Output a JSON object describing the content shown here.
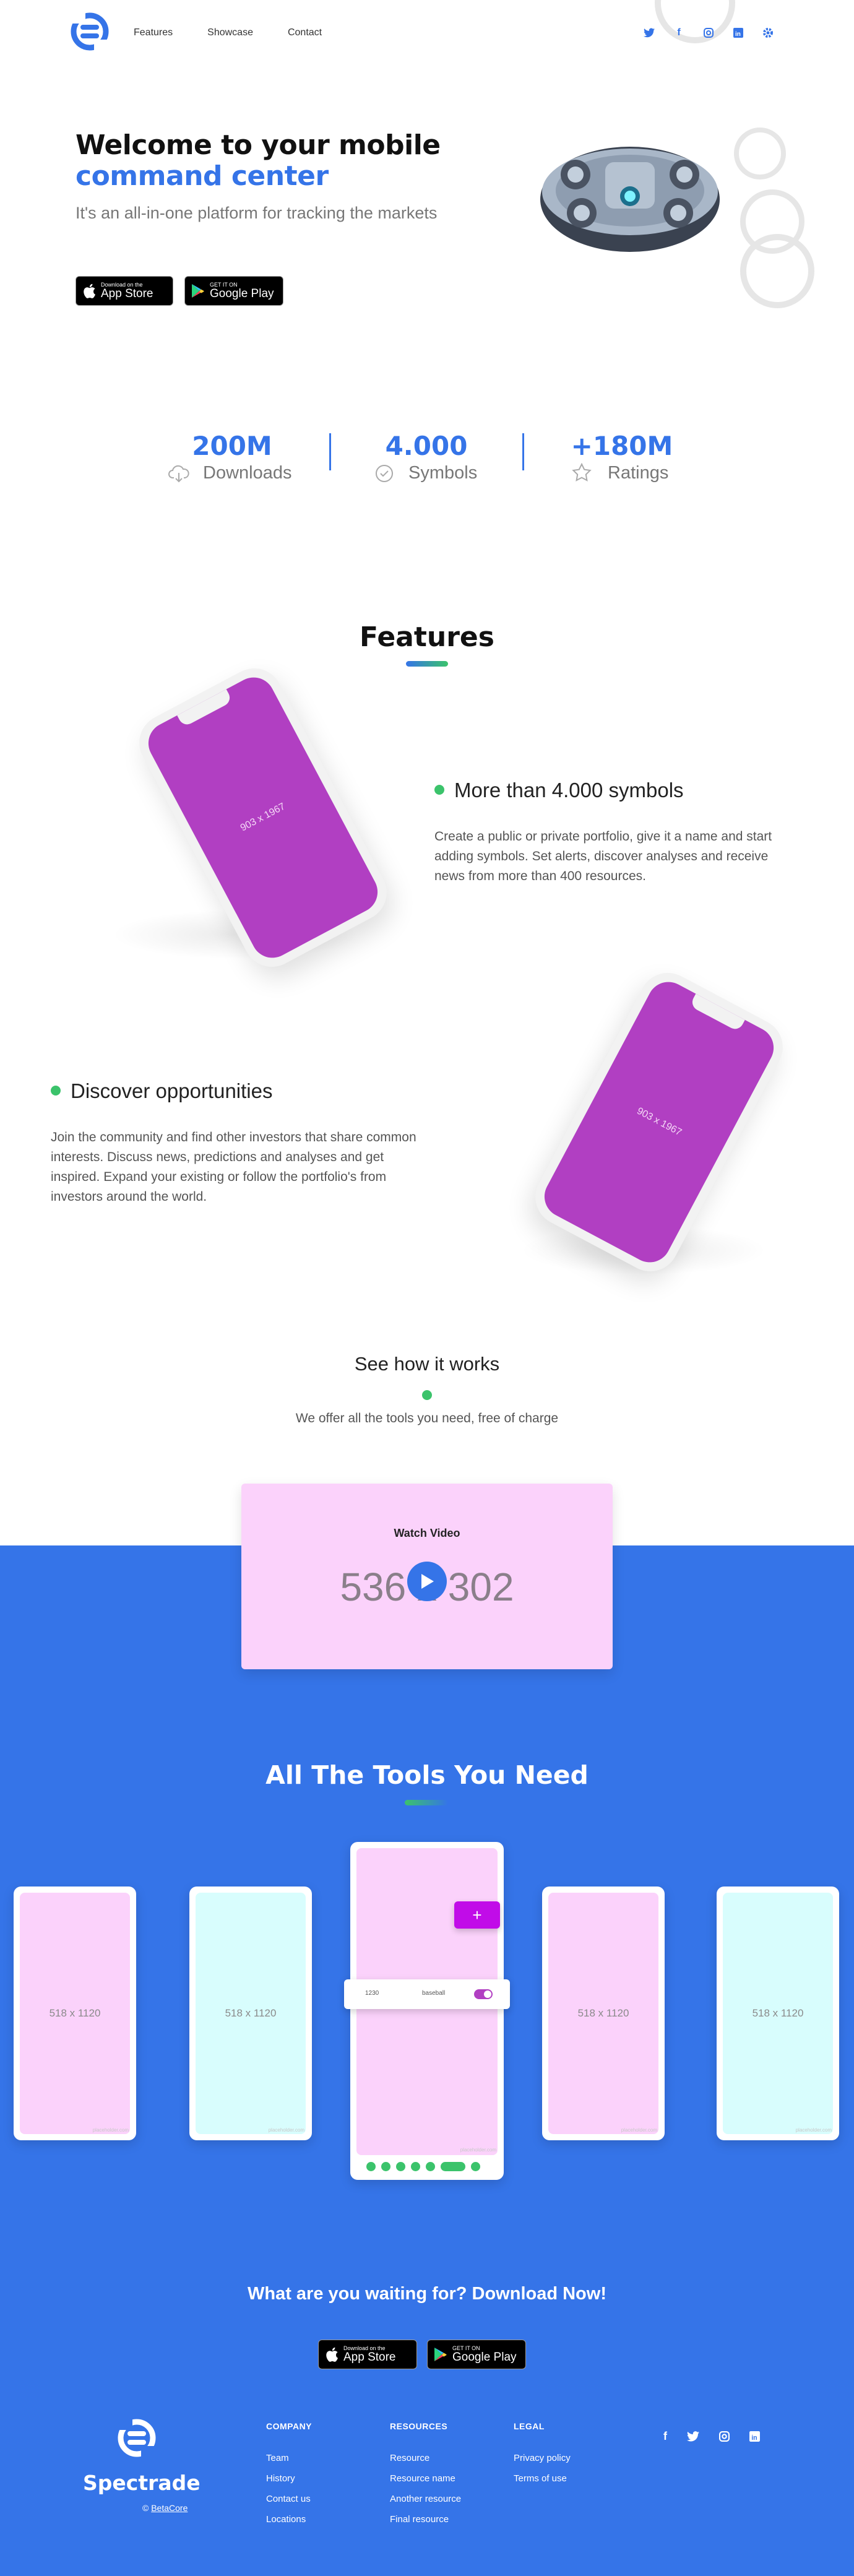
{
  "header": {
    "nav": [
      "Features",
      "Showcase",
      "Contact"
    ],
    "social_icons": [
      "twitter-icon",
      "facebook-icon",
      "instagram-icon",
      "linkedin-icon",
      "settings-icon"
    ]
  },
  "hero": {
    "title_line1": "Welcome to your mobile",
    "title_line2": "command center",
    "subtitle": "It's an all-in-one platform for tracking the markets",
    "app_store": {
      "small": "Download on the",
      "large": "App Store"
    },
    "google_play": {
      "small": "GET IT ON",
      "large": "Google Play"
    }
  },
  "stats": [
    {
      "value": "200M",
      "label": "Downloads",
      "icon": "cloud-download-icon"
    },
    {
      "value": "4.000",
      "label": "Symbols",
      "icon": "check-circle-icon"
    },
    {
      "value": "+180M",
      "label": "Ratings",
      "icon": "star-icon"
    }
  ],
  "features": {
    "title": "Features",
    "items": [
      {
        "heading": "More than 4.000 symbols",
        "text": "Create a public or private portfolio, give it a name and start adding symbols. Set alerts, discover analyses and receive news from more than 400 resources.",
        "placeholder": "903 x 1967"
      },
      {
        "heading": "Discover opportunities",
        "text": "Join the community and find other investors that share common interests. Discuss news, predictions and analyses and get inspired. Expand your existing or follow the portfolio's from investors around the world.",
        "placeholder": "903 x 1967"
      }
    ]
  },
  "how_it_works": {
    "title": "See how it works",
    "subtitle": "We offer all the tools you need, free of charge",
    "video_label": "Watch Video",
    "video_placeholder": "536 x 302"
  },
  "tools": {
    "title": "All The Tools You Need",
    "placeholder": "518 x 1120",
    "watermark": "placeholder.com",
    "center_card": {
      "left": "1230",
      "middle": "baseball"
    },
    "plus": "+"
  },
  "download": {
    "title": "What are you waiting for? Download Now!"
  },
  "footer": {
    "brand": "Spectrade",
    "copyright_prefix": "©",
    "copyright_link": "BetaCore",
    "columns": [
      {
        "heading": "COMPANY",
        "items": [
          "Team",
          "History",
          "Contact us",
          "Locations"
        ]
      },
      {
        "heading": "RESOURCES",
        "items": [
          "Resource",
          "Resource name",
          "Another resource",
          "Final resource"
        ]
      },
      {
        "heading": "LEGAL",
        "items": [
          "Privacy policy",
          "Terms of use"
        ]
      }
    ],
    "social_icons": [
      "facebook-icon",
      "twitter-icon",
      "instagram-icon",
      "linkedin-icon"
    ]
  },
  "colors": {
    "brand_blue": "#3574e8",
    "green": "#3bc36b",
    "purple_screen": "#b13fc2",
    "pink_placeholder": "#fbd2fb",
    "cyan_placeholder": "#d8fdfd"
  }
}
